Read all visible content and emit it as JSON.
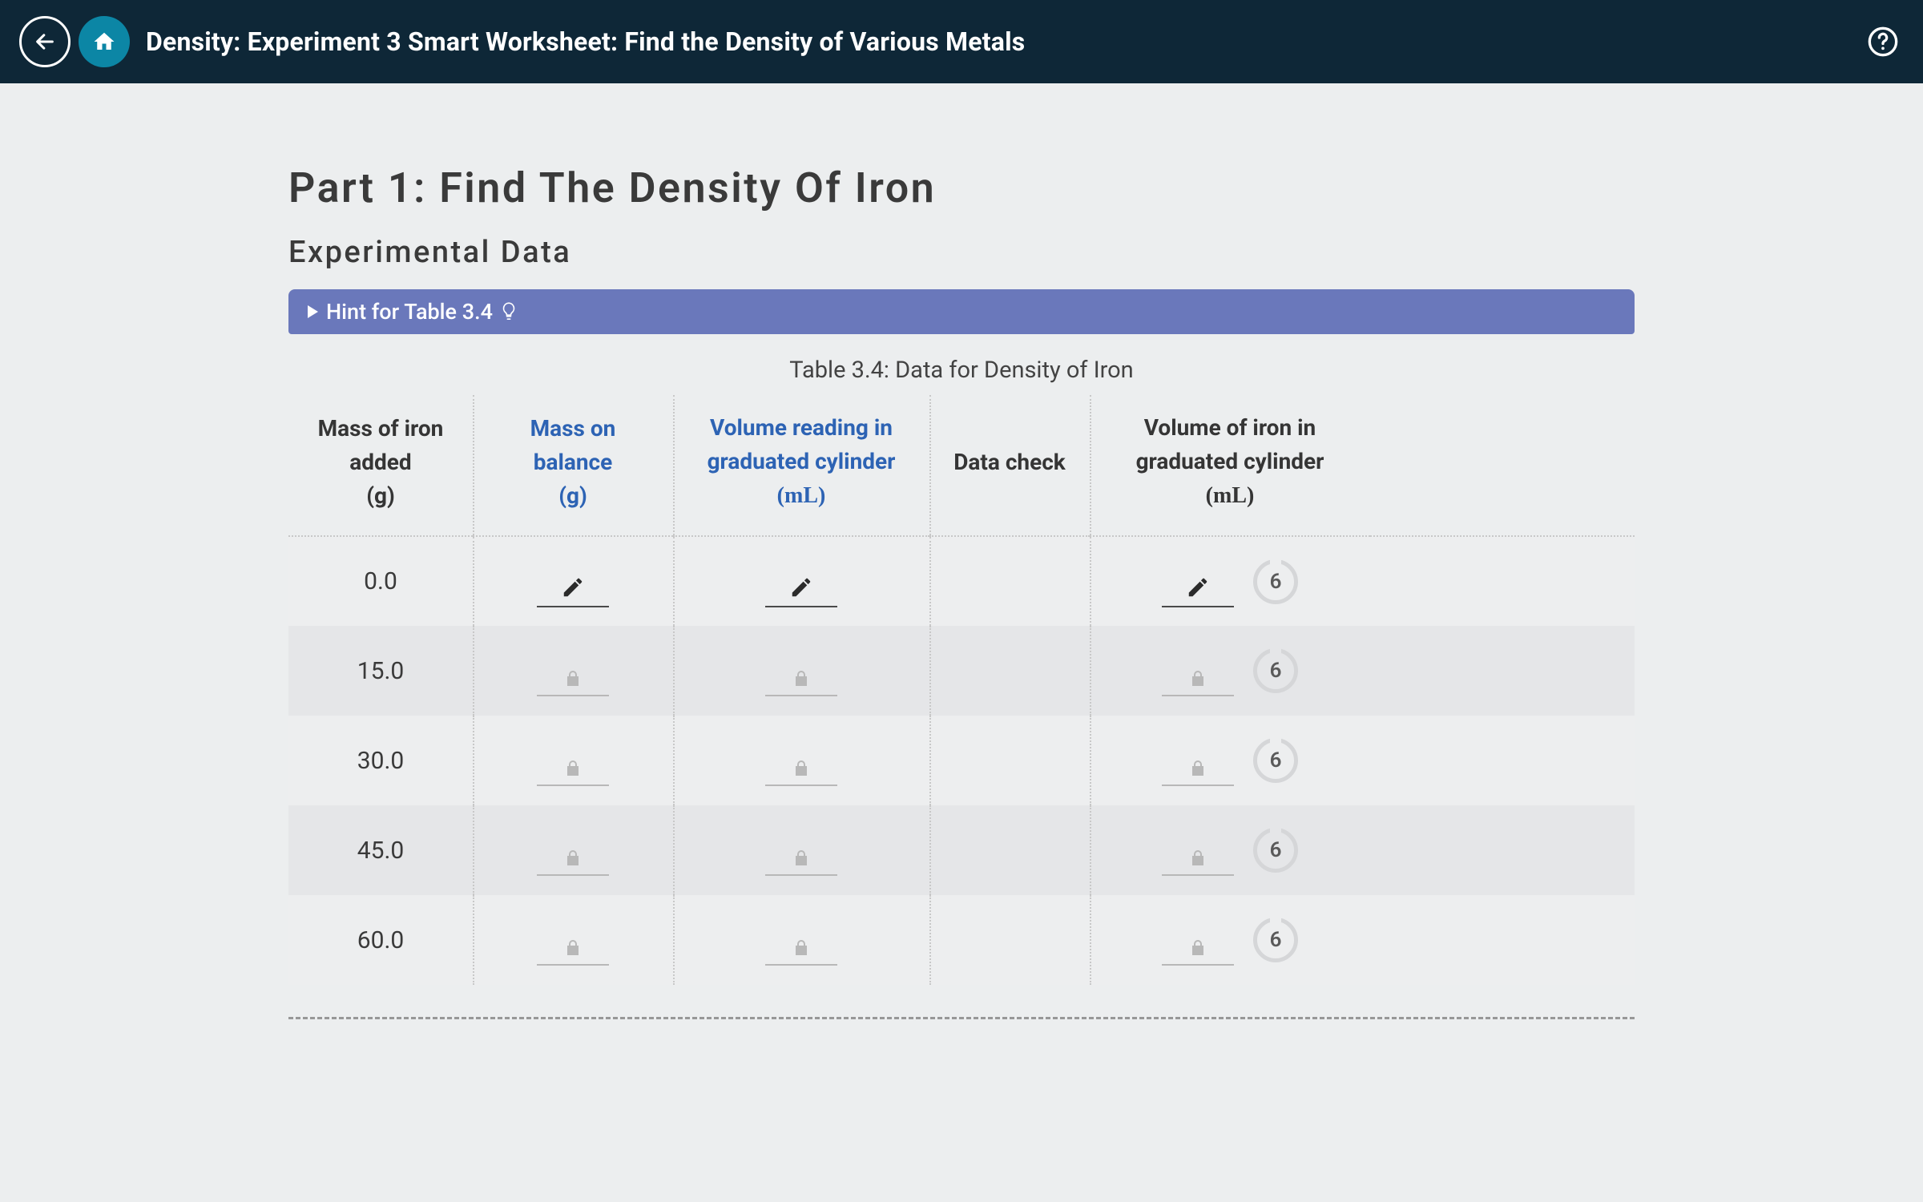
{
  "header": {
    "title": "Density: Experiment 3 Smart Worksheet: Find the Density of Various Metals"
  },
  "main": {
    "heading": "Part 1: Find The Density Of Iron",
    "subheading": "Experimental Data",
    "hint_label": "Hint for Table 3.4",
    "table_caption": "Table 3.4: Data for Density of Iron",
    "columns": {
      "mass_added": {
        "line1": "Mass of iron",
        "line2": "added",
        "unit": "(g)"
      },
      "mass_balance": {
        "line1": "Mass on",
        "line2": "balance",
        "unit": "(g)"
      },
      "vol_reading": {
        "line1": "Volume reading in",
        "line2": "graduated cylinder",
        "unit": "(mL)"
      },
      "data_check": {
        "line1": "Data check"
      },
      "vol_iron": {
        "line1": "Volume of iron in",
        "line2": "graduated cylinder",
        "unit": "(mL)"
      }
    },
    "rows": [
      {
        "mass_added": "0.0",
        "state": "editable",
        "badge": "6"
      },
      {
        "mass_added": "15.0",
        "state": "locked",
        "badge": "6"
      },
      {
        "mass_added": "30.0",
        "state": "locked",
        "badge": "6"
      },
      {
        "mass_added": "45.0",
        "state": "locked",
        "badge": "6"
      },
      {
        "mass_added": "60.0",
        "state": "locked",
        "badge": "6"
      }
    ]
  }
}
